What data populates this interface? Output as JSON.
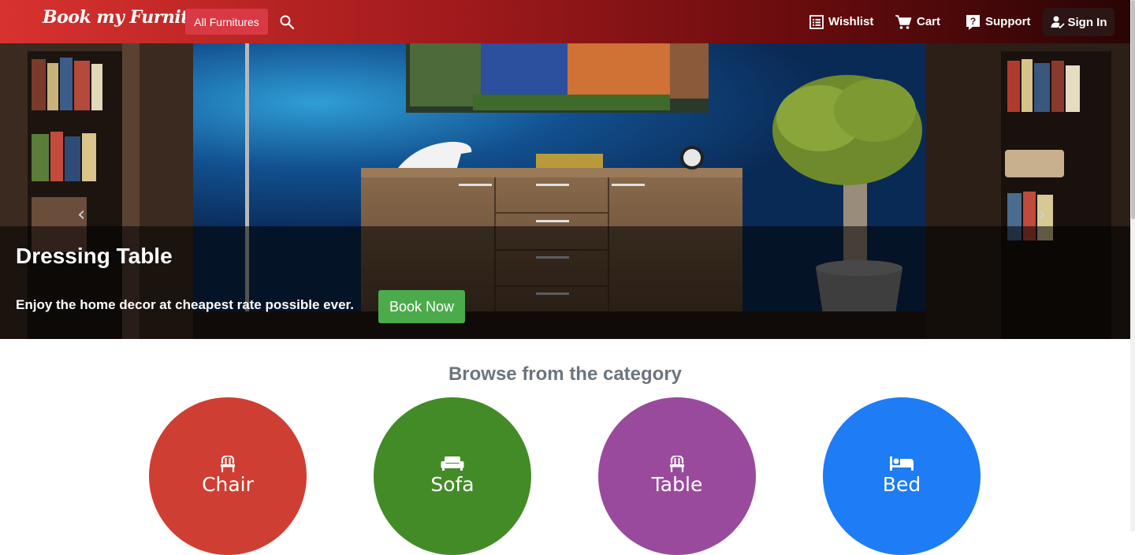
{
  "brand": "Book my Furniture",
  "nav": {
    "all_furnitures": "All Furnitures",
    "wishlist": "Wishlist",
    "cart": "Cart",
    "support": "Support",
    "signin": "Sign In"
  },
  "hero": {
    "title": "Dressing Table",
    "subtitle": "Enjoy the home decor at cheapest rate possible ever.",
    "button": "Book Now"
  },
  "categories": {
    "title": "Browse from the category",
    "items": [
      {
        "label": "Chair",
        "color": "#cf3e32",
        "icon": "chair-icon"
      },
      {
        "label": "Sofa",
        "color": "#438b27",
        "icon": "sofa-icon"
      },
      {
        "label": "Table",
        "color": "#9a4a9c",
        "icon": "chair-icon"
      },
      {
        "label": "Bed",
        "color": "#1e7cf4",
        "icon": "bed-icon"
      }
    ]
  },
  "colors": {
    "navbar_start": "#d8322f",
    "navbar_end": "#2a0404",
    "all_button": "#d93944",
    "book_button": "#4bab4b",
    "section_title": "#6c757d"
  }
}
